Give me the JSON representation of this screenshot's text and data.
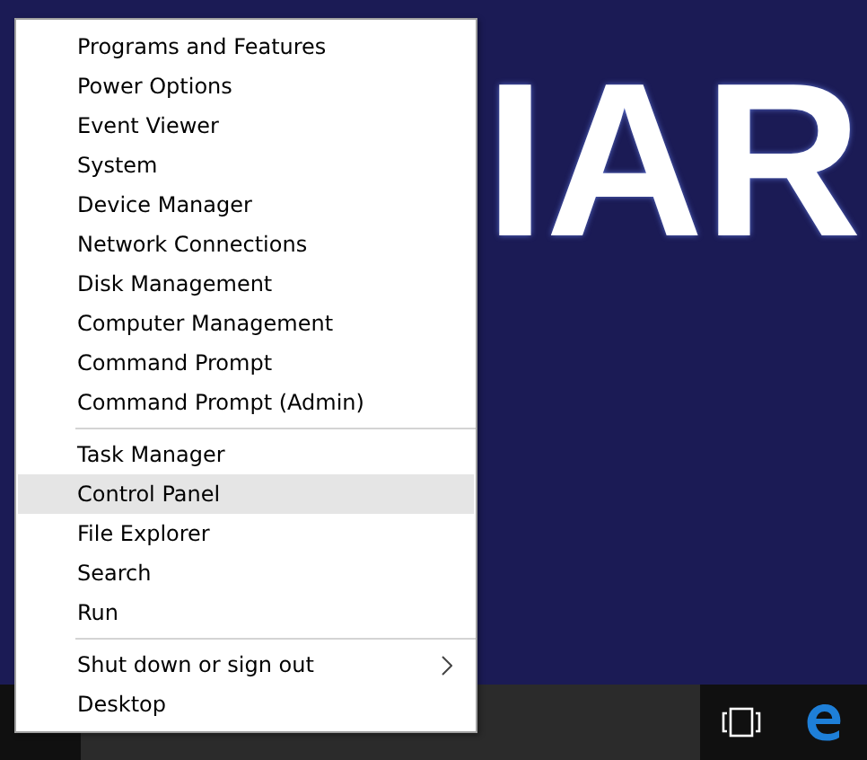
{
  "wallpaper": {
    "text": "IAR"
  },
  "menu": {
    "groups": [
      {
        "items": [
          {
            "label": "Programs and Features",
            "selected": false,
            "submenu": false
          },
          {
            "label": "Power Options",
            "selected": false,
            "submenu": false
          },
          {
            "label": "Event Viewer",
            "selected": false,
            "submenu": false
          },
          {
            "label": "System",
            "selected": false,
            "submenu": false
          },
          {
            "label": "Device Manager",
            "selected": false,
            "submenu": false
          },
          {
            "label": "Network Connections",
            "selected": false,
            "submenu": false
          },
          {
            "label": "Disk Management",
            "selected": false,
            "submenu": false
          },
          {
            "label": "Computer Management",
            "selected": false,
            "submenu": false
          },
          {
            "label": "Command Prompt",
            "selected": false,
            "submenu": false
          },
          {
            "label": "Command Prompt (Admin)",
            "selected": false,
            "submenu": false
          }
        ]
      },
      {
        "items": [
          {
            "label": "Task Manager",
            "selected": false,
            "submenu": false
          },
          {
            "label": "Control Panel",
            "selected": true,
            "submenu": false
          },
          {
            "label": "File Explorer",
            "selected": false,
            "submenu": false
          },
          {
            "label": "Search",
            "selected": false,
            "submenu": false
          },
          {
            "label": "Run",
            "selected": false,
            "submenu": false
          }
        ]
      },
      {
        "items": [
          {
            "label": "Shut down or sign out",
            "selected": false,
            "submenu": true
          },
          {
            "label": "Desktop",
            "selected": false,
            "submenu": false
          }
        ]
      }
    ]
  }
}
